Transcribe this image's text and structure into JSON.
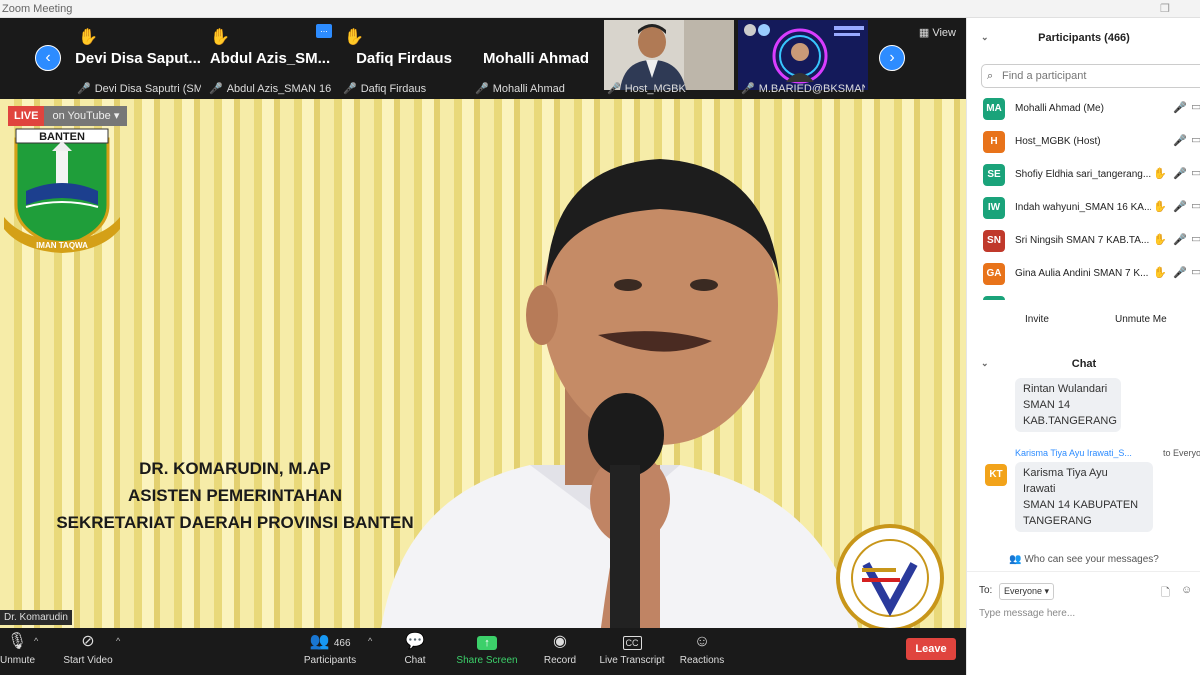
{
  "window": {
    "title": "Zoom Meeting"
  },
  "strip": {
    "tiles": [
      {
        "name": "Devi  Disa Saput...",
        "sub": "Devi Disa Saputri (SM..."
      },
      {
        "name": "Abdul  Azis_SM...",
        "sub": "Abdul Azis_SMAN 16 ..."
      },
      {
        "name": "Dafiq Firdaus",
        "sub": "Dafiq Firdaus"
      },
      {
        "name": "Mohalli Ahmad",
        "sub": "Mohalli Ahmad"
      }
    ],
    "videos": [
      {
        "sub": "Host_MGBK"
      },
      {
        "sub": "M.BARIED@BKSMAN5..."
      }
    ],
    "more": "...",
    "view": "View"
  },
  "main": {
    "live": "LIVE",
    "on_youtube": "on YouTube",
    "logo_text_top": "BANTEN",
    "logo_text_bottom": "IMAN TAQWA",
    "caption": [
      "DR. KOMARUDIN, M.AP",
      "ASISTEN PEMERINTAHAN",
      "SEKRETARIAT DAERAH PROVINSI BANTEN"
    ],
    "speaker_label": "Dr. Komarudin"
  },
  "toolbar": {
    "unmute": "Unmute",
    "start_video": "Start Video",
    "participants": "Participants",
    "participants_count": "466",
    "chat": "Chat",
    "share_screen": "Share Screen",
    "record": "Record",
    "live_transcript": "Live Transcript",
    "reactions": "Reactions",
    "leave": "Leave"
  },
  "panel": {
    "participants_title": "Participants (466)",
    "search_placeholder": "Find a participant",
    "participants": [
      {
        "initials": "MA",
        "name": "Mohalli Ahmad (Me)",
        "color": "#1aa37a",
        "hand": false
      },
      {
        "initials": "H",
        "name": "Host_MGBK (Host)",
        "color": "#e8731a",
        "hand": false
      },
      {
        "initials": "SE",
        "name": "Shofiy Eldhia sari_tangerang...",
        "color": "#1aa37a",
        "hand": true
      },
      {
        "initials": "IW",
        "name": "Indah wahyuni_SMAN 16 KA...",
        "color": "#1aa37a",
        "hand": true
      },
      {
        "initials": "SN",
        "name": "Sri Ningsih SMAN 7 KAB.TA...",
        "color": "#c0392b",
        "hand": true
      },
      {
        "initials": "GA",
        "name": "Gina Aulia Andini SMAN 7 K...",
        "color": "#e8731a",
        "hand": true
      }
    ],
    "invite": "Invite",
    "unmute_me": "Unmute Me",
    "chat_title": "Chat",
    "messages": [
      {
        "lines": [
          "Rintan Wulandari",
          "SMAN 14",
          "KAB.TANGERANG"
        ]
      },
      {
        "sender": "Karisma Tiya Ayu Irawati_S...",
        "to": "to Everyone",
        "initials": "KT",
        "lines": [
          "Karisma Tiya Ayu",
          "Irawati",
          "SMAN 14 KABUPATEN",
          "TANGERANG"
        ]
      }
    ],
    "who_can_see": "Who can see your messages?",
    "to_label": "To:",
    "to_value": "Everyone",
    "message_placeholder": "Type message here..."
  },
  "colors": {
    "accent": "#2d8cff",
    "leave": "#e0443e",
    "raise_hand": "#f2b533"
  }
}
